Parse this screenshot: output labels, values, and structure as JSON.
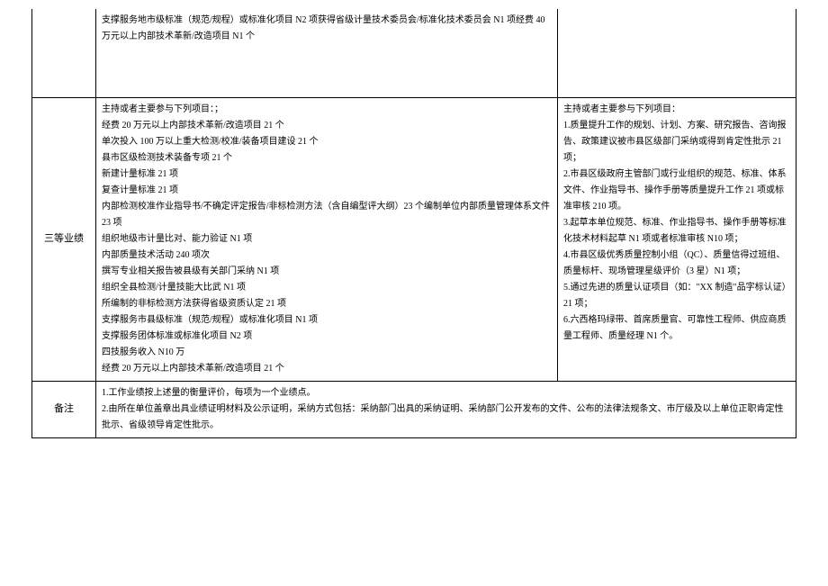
{
  "row1": {
    "mid": "支撑服务地市级标准（规范/规程）或标准化项目 N2 项获得省级计量技术委员会/标准化技术委员会 N1 项经费 40 万元以上内部技术革新/改造项目 N1 个",
    "right": ""
  },
  "row2": {
    "label": "三等业绩",
    "mid": [
      "主持或者主要参与下列项目：；",
      "经费 20 万元以上内部技术革新/改造项目 21 个",
      "单次投入 100 万以上重大检测/校准/装备项目建设 21 个",
      "县市区级检测技术装备专项 21 个",
      "新建计量标准 21 项",
      "复查计量标准 21 项",
      "内部检测校准作业指导书/不确定评定报告/非标检测方法（含自编型评大纲）23 个编制单位内部质量管理体系文件 23 项",
      "组织地级市计量比对、能力验证 N1 项",
      "内部质量技术活动 240 项次",
      "撰写专业相关报告被县级有关部门采纳 N1 项",
      "组织全县检测/计量技能大比武 N1 项",
      "所编制的非标检测方法获得省级资质认定 21 项",
      "支撑服务市县级标准（规范/规程）或标准化项目 N1 项",
      "支撑服务团体标准或标准化项目 N2 项",
      "四技服务收入 N10 万",
      "经费 20 万元以上内部技术革新/改造项目 21 个"
    ],
    "right": [
      "主持或者主要参与下列项目：",
      "1.质量提升工作的规划、计划、方案、研究报告、咨询报告、政策建议被市县区级部门采纳或得到肯定性批示 21 项；",
      "2.市县区级政府主管部门或行业组织的规范、标准、体系文件、作业指导书、操作手册等质量提升工作 21 项或标准审核 210 项。",
      "3.起草本单位规范、标准、作业指导书、操作手册等标准化技术材料起草 N1 项或者标准审核 N10 项；",
      "4.市县区级优秀质量控制小组（QC）、质量信得过班组、质量标杆、现场管理星级评价（3 星）N1 项；",
      "5.通过先进的质量认证项目（如：\"XX 制造\"品字标认证）21 项；",
      "6.六西格玛绿带、首席质量官、可靠性工程师、供应商质量工程师、质量经理 N1 个。"
    ]
  },
  "remarks": {
    "label": "备注",
    "content": [
      "1.工作业绩按上述量的衡量评价，每项为一个业绩点。",
      "2.由所在单位盖章出具业绩证明材料及公示证明，采纳方式包括：采纳部门出具的采纳证明、采纳部门公开发布的文件、公布的法律法规条文、市厅级及以上单位正职肯定性批示、省级领导肯定性批示。"
    ]
  }
}
